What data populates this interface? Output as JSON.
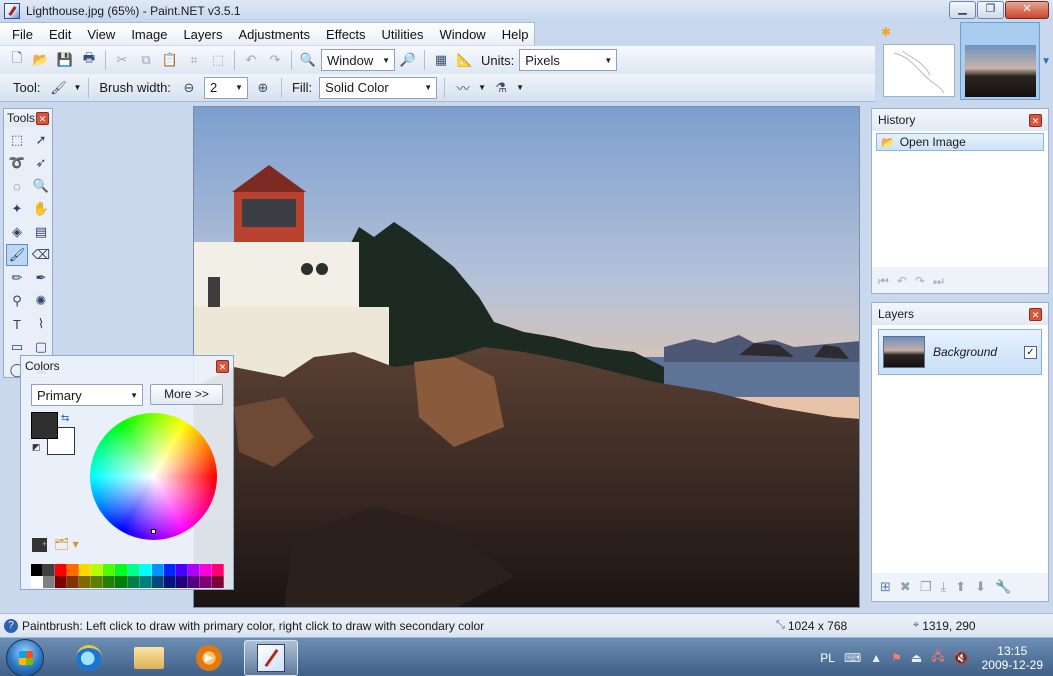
{
  "window": {
    "title": "Lighthouse.jpg (65%) - Paint.NET v3.5.1",
    "buttons": {
      "minimize": "▁",
      "maximize": "❐",
      "close": "✕"
    }
  },
  "menu": [
    "File",
    "Edit",
    "View",
    "Image",
    "Layers",
    "Adjustments",
    "Effects",
    "Utilities",
    "Window",
    "Help"
  ],
  "toolbar": {
    "zoom_value": "Window",
    "units_label": "Units:",
    "units_value": "Pixels"
  },
  "toolbar2": {
    "tool_label": "Tool:",
    "brush_width_label": "Brush width:",
    "brush_width_value": "2",
    "fill_label": "Fill:",
    "fill_value": "Solid Color"
  },
  "tools_panel": {
    "title": "Tools"
  },
  "colors_panel": {
    "title": "Colors",
    "mode_value": "Primary",
    "more_button": "More >>",
    "primary_color": "#2f2f2f",
    "secondary_color": "#ffffff",
    "palette_row1": [
      "#000000",
      "#404040",
      "#ff0000",
      "#ff6a00",
      "#ffd800",
      "#b6ff00",
      "#4cff00",
      "#00ff21",
      "#00ff90",
      "#00ffff",
      "#0094ff",
      "#0026ff",
      "#4800ff",
      "#b200ff",
      "#ff00dc",
      "#ff006e"
    ],
    "palette_row2": [
      "#ffffff",
      "#808080",
      "#7f0000",
      "#7f3300",
      "#7f6a00",
      "#5b7f00",
      "#267f00",
      "#007f0e",
      "#007f46",
      "#007f7f",
      "#004a7f",
      "#00137f",
      "#21007f",
      "#57007f",
      "#7f006e",
      "#7f0037"
    ]
  },
  "history_panel": {
    "title": "History",
    "items": [
      "Open Image"
    ]
  },
  "layers_panel": {
    "title": "Layers",
    "layers": [
      {
        "name": "Background",
        "visible": true
      }
    ]
  },
  "statusbar": {
    "message": "Paintbrush: Left click to draw with primary color, right click to draw with secondary color",
    "image_size": "1024 x 768",
    "cursor_position": "1319, 290"
  },
  "taskbar": {
    "language": "PL",
    "time": "13:15",
    "date": "2009-12-29"
  },
  "icons": {
    "accent": "#3b6fb6",
    "close": "#d9553c"
  }
}
